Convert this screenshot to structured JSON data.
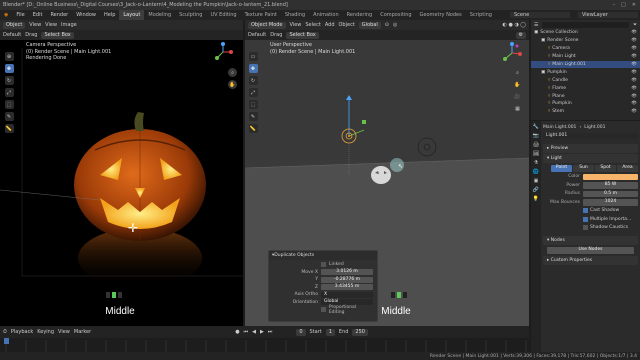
{
  "window": {
    "title": "Blender* [D:_Online Business\\_Digital Courses\\3_Jack-o-Lantern\\4_Modeling the Pumpkin\\Jack-o-lantern_21.blend]",
    "controls": [
      "–",
      "□",
      "✕"
    ]
  },
  "menu": {
    "items": [
      "File",
      "Edit",
      "Render",
      "Window",
      "Help"
    ],
    "workspaces": [
      "Layout",
      "Modeling",
      "Sculpting",
      "UV Editing",
      "Texture Paint",
      "Shading",
      "Animation",
      "Rendering",
      "Compositing",
      "Geometry Nodes",
      "Scripting"
    ],
    "active_workspace": "Layout",
    "scene": "Scene",
    "view_layer": "ViewLayer"
  },
  "left_view": {
    "header": {
      "mode": "Object",
      "menus": [
        "View",
        "View",
        "Image"
      ]
    },
    "overlay": [
      "Camera Perspective",
      "(0) Render Scene | Main Light.001",
      "Rendering Done"
    ],
    "caption": "Middle",
    "bottom_icons": [
      "◻",
      "◼",
      "◻"
    ]
  },
  "right_view": {
    "header": {
      "mode": "Object Mode",
      "menus": [
        "View",
        "Select",
        "Add",
        "Object"
      ],
      "transform": "Global"
    },
    "subheader": {
      "orientation": "Default",
      "drag_label": "Drag",
      "drag_value": "Select Box"
    },
    "overlay": [
      "User Perspective",
      "(0) Render Scene | Main Light.001"
    ],
    "caption": "Middle",
    "bottom_icons": [
      "◻",
      "◼",
      "◻"
    ]
  },
  "left_subheader": {
    "orientation": "Default",
    "drag_label": "Drag",
    "drag_value": "Select Box"
  },
  "operator_panel": {
    "title": "Duplicate Objects",
    "linked_label": "Linked",
    "move_label": "Move X",
    "move": [
      {
        "axis": "X",
        "value": "3.0126 m"
      },
      {
        "axis": "Y",
        "value": "-0.28776 m"
      },
      {
        "axis": "Z",
        "value": "3.43455 m"
      }
    ],
    "axis_ortho_label": "Axis Ortho",
    "axis_ortho": "X",
    "orientation_label": "Orientation",
    "orientation": "Global",
    "proportional_label": "Proportional Editing"
  },
  "outliner": {
    "header": "Scene Collection",
    "rows": [
      {
        "label": "Scene Collection",
        "indent": 0,
        "selected": false
      },
      {
        "label": "Render Scene",
        "indent": 1,
        "selected": false
      },
      {
        "label": "Camera",
        "indent": 2,
        "selected": false
      },
      {
        "label": "Main Light",
        "indent": 2,
        "selected": false
      },
      {
        "label": "Main Light.001",
        "indent": 2,
        "selected": true
      },
      {
        "label": "Pumpkin",
        "indent": 1,
        "selected": false
      },
      {
        "label": "Candle",
        "indent": 2,
        "selected": false
      },
      {
        "label": "Flame",
        "indent": 2,
        "selected": false
      },
      {
        "label": "Plane",
        "indent": 2,
        "selected": false
      },
      {
        "label": "Pumpkin",
        "indent": 2,
        "selected": false
      },
      {
        "label": "Stem",
        "indent": 2,
        "selected": false
      }
    ]
  },
  "properties": {
    "breadcrumb": [
      "Main Light.001",
      "Light.001"
    ],
    "datablock": "Light.001",
    "sections": {
      "preview": "Preview",
      "light": "Light",
      "nodes": "Nodes",
      "custom": "Custom Properties"
    },
    "light_types": [
      "Point",
      "Sun",
      "Spot",
      "Area"
    ],
    "active_type": "Point",
    "fields": [
      {
        "label": "Color",
        "value": ""
      },
      {
        "label": "Power",
        "value": "85 W"
      },
      {
        "label": "Radius",
        "value": "0.5 m"
      },
      {
        "label": "Max Bounces",
        "value": "1024"
      }
    ],
    "checks": [
      "Cast Shadow",
      "Multiple Importa...",
      "Shadow Caustics"
    ],
    "use_nodes": "Use Nodes",
    "color_swatch": "#f7b46a"
  },
  "timeline": {
    "menus": [
      "Playback",
      "Keying",
      "View",
      "Marker"
    ],
    "frame": "0",
    "start_label": "Start",
    "start": "1",
    "end_label": "End",
    "end": "250"
  },
  "status": {
    "text": "Render Scene | Main Light.001 | Verts:39,306 | Faces:39,178 | Tris:57,602 | Objects:1/7 | 3.4"
  },
  "colors": {
    "accent": "#4772b3",
    "selected_row": "#334d80",
    "light_color": "#f7b46a"
  }
}
